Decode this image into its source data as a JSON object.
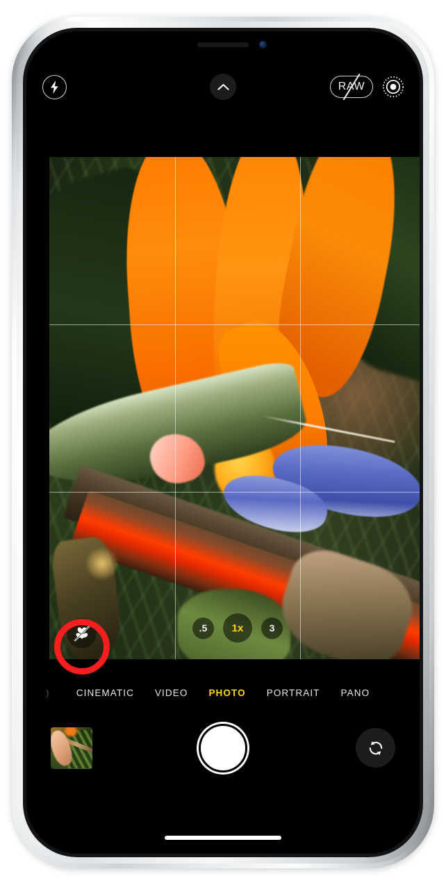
{
  "app": {
    "name": "Camera",
    "device": "iPhone",
    "screen_state": "viewfinder-active"
  },
  "top_controls": {
    "flash": {
      "label": "Flash",
      "icon": "flash-icon",
      "state": "auto"
    },
    "more": {
      "label": "More Controls",
      "icon": "chevron-up-icon",
      "state": "collapsed"
    },
    "raw": {
      "label": "RAW",
      "icon": "raw-off-icon",
      "state": "off"
    },
    "live_photo": {
      "label": "Live Photo",
      "icon": "live-photo-icon",
      "state": "on"
    }
  },
  "viewfinder": {
    "grid_enabled": true,
    "subject": "Bird of paradise flower",
    "zoom_options": [
      {
        "label": ".5",
        "value": "0.5x",
        "active": false
      },
      {
        "label": "1x",
        "value": "1x",
        "active": true
      },
      {
        "label": "3",
        "value": "3x",
        "active": false
      }
    ],
    "macro_toggle": {
      "label": "Macro Control",
      "icon": "macro-off-icon",
      "state": "off",
      "highlighted": true,
      "highlight_color": "#f61e1e"
    }
  },
  "mode_selector": {
    "modes": [
      {
        "label": "CINEMATIC",
        "active": false
      },
      {
        "label": "VIDEO",
        "active": false
      },
      {
        "label": "PHOTO",
        "active": true
      },
      {
        "label": "PORTRAIT",
        "active": false
      },
      {
        "label": "PANO",
        "active": false
      }
    ],
    "active_color": "#ffd60a"
  },
  "bottom_controls": {
    "photo_thumbnail": {
      "label": "Photo Library",
      "icon": "thumbnail-icon"
    },
    "shutter": {
      "label": "Take Picture",
      "icon": "shutter-icon"
    },
    "flip_camera": {
      "label": "Switch Cameras",
      "icon": "camera-flip-icon"
    }
  },
  "system": {
    "home_indicator": true,
    "notch": true
  }
}
